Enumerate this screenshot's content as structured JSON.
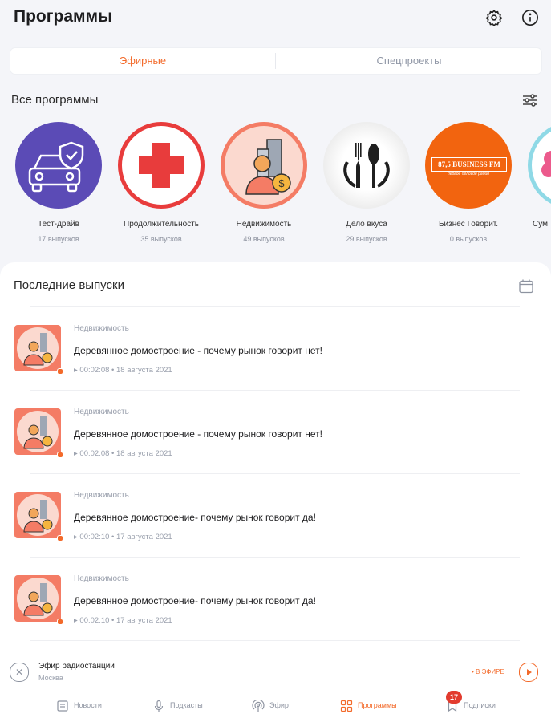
{
  "header": {
    "title": "Программы"
  },
  "tabs": [
    {
      "label": "Эфирные",
      "active": true
    },
    {
      "label": "Спецпроекты",
      "active": false
    }
  ],
  "all_programs": {
    "title": "Все программы",
    "items": [
      {
        "name": "Тест-драйв",
        "count": "17 выпусков"
      },
      {
        "name": "Продолжительность",
        "count": "35 выпусков"
      },
      {
        "name": "Недвижимость",
        "count": "49 выпусков"
      },
      {
        "name": "Дело вкуса",
        "count": "29 выпусков"
      },
      {
        "name": "Бизнес Говорит.",
        "count": "0 выпусков",
        "logo_text": "87,5 BUSINESS FM",
        "logo_tag": "первое деловое радио"
      },
      {
        "name": "Сум"
      }
    ]
  },
  "latest": {
    "title": "Последние выпуски",
    "episodes": [
      {
        "category": "Недвижимость",
        "title": "Деревянное домостроение - почему рынок говорит нет!",
        "duration": "00:02:08",
        "date": "18 августа 2021"
      },
      {
        "category": "Недвижимость",
        "title": "Деревянное домостроение - почему рынок говорит нет!",
        "duration": "00:02:08",
        "date": "18 августа 2021"
      },
      {
        "category": "Недвижимость",
        "title": "Деревянное домостроение- почему рынок говорит да!",
        "duration": "00:02:10",
        "date": "17 августа 2021"
      },
      {
        "category": "Недвижимость",
        "title": "Деревянное домостроение- почему рынок говорит да!",
        "duration": "00:02:10",
        "date": "17 августа 2021"
      }
    ]
  },
  "player": {
    "title": "Эфир радиостанции",
    "subtitle": "Москва",
    "live_label": "• В ЭФИРЕ"
  },
  "nav": {
    "items": [
      {
        "label": "Новости",
        "icon": "news-icon"
      },
      {
        "label": "Подкасты",
        "icon": "microphone-icon"
      },
      {
        "label": "Эфир",
        "icon": "broadcast-icon"
      },
      {
        "label": "Программы",
        "icon": "grid-icon",
        "active": true
      },
      {
        "label": "Подписки",
        "icon": "bookmark-icon",
        "badge": "17"
      }
    ]
  },
  "colors": {
    "accent": "#f36a2a",
    "background": "#f4f5f9"
  }
}
